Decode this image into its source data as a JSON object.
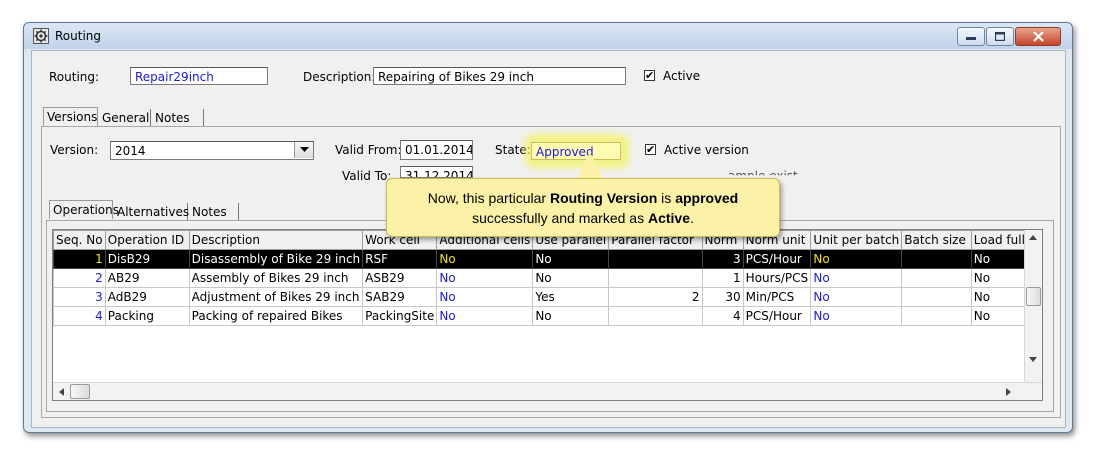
{
  "window": {
    "title": "Routing",
    "accent": "#c0d3ea"
  },
  "header": {
    "routing_label": "Routing:",
    "routing_value": "Repair29inch",
    "description_label": "Description:",
    "description_value": "Repairing of Bikes 29 inch",
    "active_label": "Active",
    "active_checked": "✔"
  },
  "main_tabs": [
    "Versions",
    "General",
    "Notes"
  ],
  "version": {
    "version_label": "Version:",
    "version_value": "2014",
    "valid_from_label": "Valid From:",
    "valid_from_value": "01.01.2014",
    "valid_to_label": "Valid To:",
    "valid_to_value": "31.12.2014",
    "state_label": "State:",
    "state_value": "Approved",
    "active_version_label": "Active version",
    "active_version_checked": "✔",
    "partial_text": "ample exist"
  },
  "sub_tabs": [
    "Operations",
    "Alternatives",
    "Notes"
  ],
  "grid": {
    "columns": [
      "Seq. No",
      "Operation ID",
      "Description",
      "Work cell",
      "Additional cells",
      "Use parallel",
      "Parallel factor",
      "Norm",
      "Norm unit",
      "Unit per batch",
      "Batch size",
      "Load fully"
    ],
    "rows": [
      {
        "seq": "1",
        "op": "DisB29",
        "desc": "Disassembly of Bike 29 inch",
        "cell": "RSF",
        "add": "No",
        "par": "No",
        "pf": "",
        "norm": "3",
        "unit": "PCS/Hour",
        "upb": "No",
        "bs": "",
        "lf": "No"
      },
      {
        "seq": "2",
        "op": "AB29",
        "desc": "Assembly of Bikes 29 inch",
        "cell": "ASB29",
        "add": "No",
        "par": "No",
        "pf": "",
        "norm": "1",
        "unit": "Hours/PCS",
        "upb": "No",
        "bs": "",
        "lf": "No"
      },
      {
        "seq": "3",
        "op": "AdB29",
        "desc": "Adjustment of Bikes 29 inch",
        "cell": "SAB29",
        "add": "No",
        "par": "Yes",
        "pf": "2",
        "norm": "30",
        "unit": "Min/PCS",
        "upb": "No",
        "bs": "",
        "lf": "No"
      },
      {
        "seq": "4",
        "op": "Packing",
        "desc": "Packing of repaired Bikes",
        "cell": "PackingSite",
        "add": "No",
        "par": "No",
        "pf": "",
        "norm": "4",
        "unit": "PCS/Hour",
        "upb": "No",
        "bs": "",
        "lf": "No"
      }
    ]
  },
  "callout": {
    "part1": "Now, this particular ",
    "bold1": "Routing Version",
    "part2": " is ",
    "bold2": "approved",
    "part3": "successfully and marked as ",
    "bold3": "Active",
    "part4": "."
  }
}
